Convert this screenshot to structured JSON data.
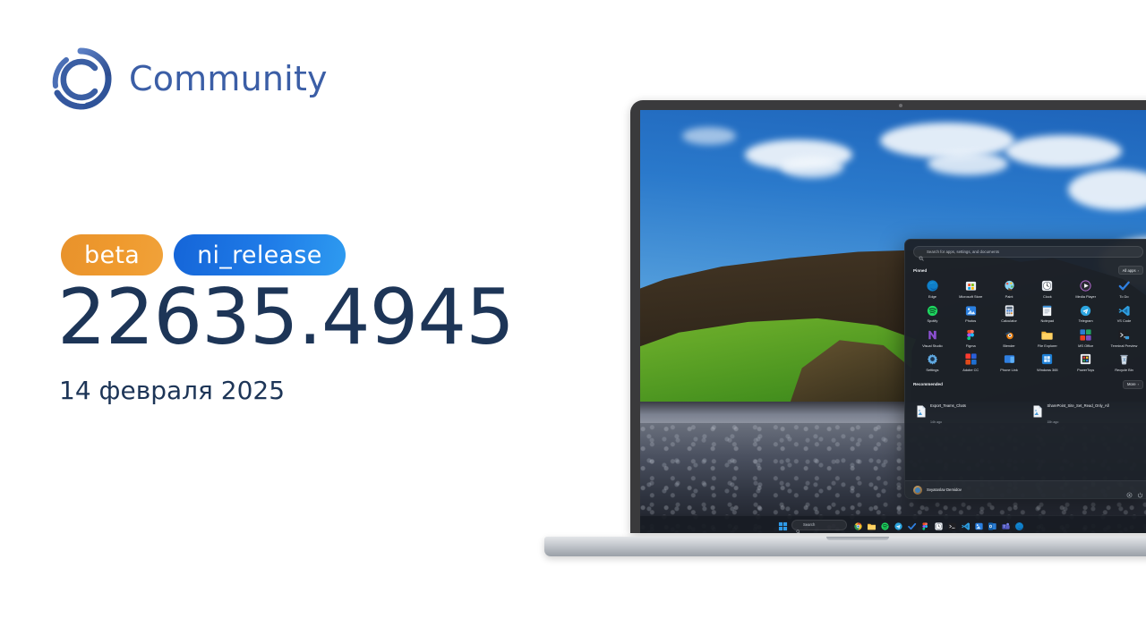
{
  "brand": {
    "name": "Community",
    "logo_icon": "community-c-logo",
    "color": "#3b5ea6"
  },
  "release": {
    "badges": [
      {
        "label": "beta",
        "color": "#ef9a2e"
      },
      {
        "label": "ni_release",
        "color": "#1f7ce8"
      }
    ],
    "build_number": "22635.4945",
    "date": "14 февраля 2025",
    "text_color": "#1d3557"
  },
  "laptop": {
    "wallpaper_description": "Iceland cliff with green grass and black pebble beach"
  },
  "start_menu": {
    "search": {
      "placeholder": "Search for apps, settings, and documents",
      "icon": "search-icon"
    },
    "pinned": {
      "title": "Pinned",
      "all_apps_label": "All apps",
      "all_apps_arrow": "›",
      "apps": [
        {
          "label": "Edge",
          "icon": "edge-icon"
        },
        {
          "label": "Microsoft Store",
          "icon": "microsoft-store-icon"
        },
        {
          "label": "Paint",
          "icon": "paint-icon"
        },
        {
          "label": "Clock",
          "icon": "clock-icon"
        },
        {
          "label": "Media Player",
          "icon": "media-player-icon"
        },
        {
          "label": "To Do",
          "icon": "to-do-icon"
        },
        {
          "label": "Spotify",
          "icon": "spotify-icon"
        },
        {
          "label": "Photos",
          "icon": "photos-icon"
        },
        {
          "label": "Calculator",
          "icon": "calculator-icon"
        },
        {
          "label": "Notepad",
          "icon": "notepad-icon"
        },
        {
          "label": "Telegram",
          "icon": "telegram-icon"
        },
        {
          "label": "VS Code",
          "icon": "vs-code-icon"
        },
        {
          "label": "Visual Studio",
          "icon": "visual-studio-icon"
        },
        {
          "label": "Figma",
          "icon": "figma-icon"
        },
        {
          "label": "Blender",
          "icon": "blender-icon"
        },
        {
          "label": "File Explorer",
          "icon": "file-explorer-icon"
        },
        {
          "label": "MS Office",
          "icon": "ms-office-icon"
        },
        {
          "label": "Terminal Preview",
          "icon": "terminal-preview-icon"
        },
        {
          "label": "Settings",
          "icon": "settings-gear-icon"
        },
        {
          "label": "Adobe CC",
          "icon": "adobe-cc-icon"
        },
        {
          "label": "Phone Link",
          "icon": "phone-link-icon"
        },
        {
          "label": "Windows 365",
          "icon": "windows-365-icon"
        },
        {
          "label": "PowerToys",
          "icon": "powertoys-icon"
        },
        {
          "label": "Recycle Bin",
          "icon": "recycle-bin-icon"
        }
      ]
    },
    "recommended": {
      "title": "Recommended",
      "more_label": "More",
      "more_arrow": "›",
      "items": [
        {
          "name": "Export_Teams_Chats",
          "time": "14h ago",
          "icon": "document-icon"
        },
        {
          "name": "SharePoint_Site_Set_Read_Only_All",
          "time": "15h ago",
          "icon": "document-icon"
        }
      ]
    },
    "account": {
      "user_name": "Svyatoslav Demidov",
      "avatar_icon": "user-avatar",
      "settings_icon": "settings-icon",
      "power_icon": "power-icon"
    }
  },
  "taskbar": {
    "start_icon": "windows-start-icon",
    "search": {
      "label": "Search",
      "icon": "search-icon",
      "assistant_icon": "copilot-icon"
    },
    "apps": [
      {
        "icon": "chrome-icon"
      },
      {
        "icon": "file-explorer-icon"
      },
      {
        "icon": "spotify-icon"
      },
      {
        "icon": "telegram-icon"
      },
      {
        "icon": "to-do-icon"
      },
      {
        "icon": "figma-icon"
      },
      {
        "icon": "clock-icon"
      },
      {
        "icon": "terminal-icon"
      },
      {
        "icon": "vs-code-icon"
      },
      {
        "icon": "photos-icon"
      },
      {
        "icon": "outlook-icon"
      },
      {
        "icon": "teams-icon"
      },
      {
        "icon": "edge-icon"
      }
    ]
  }
}
